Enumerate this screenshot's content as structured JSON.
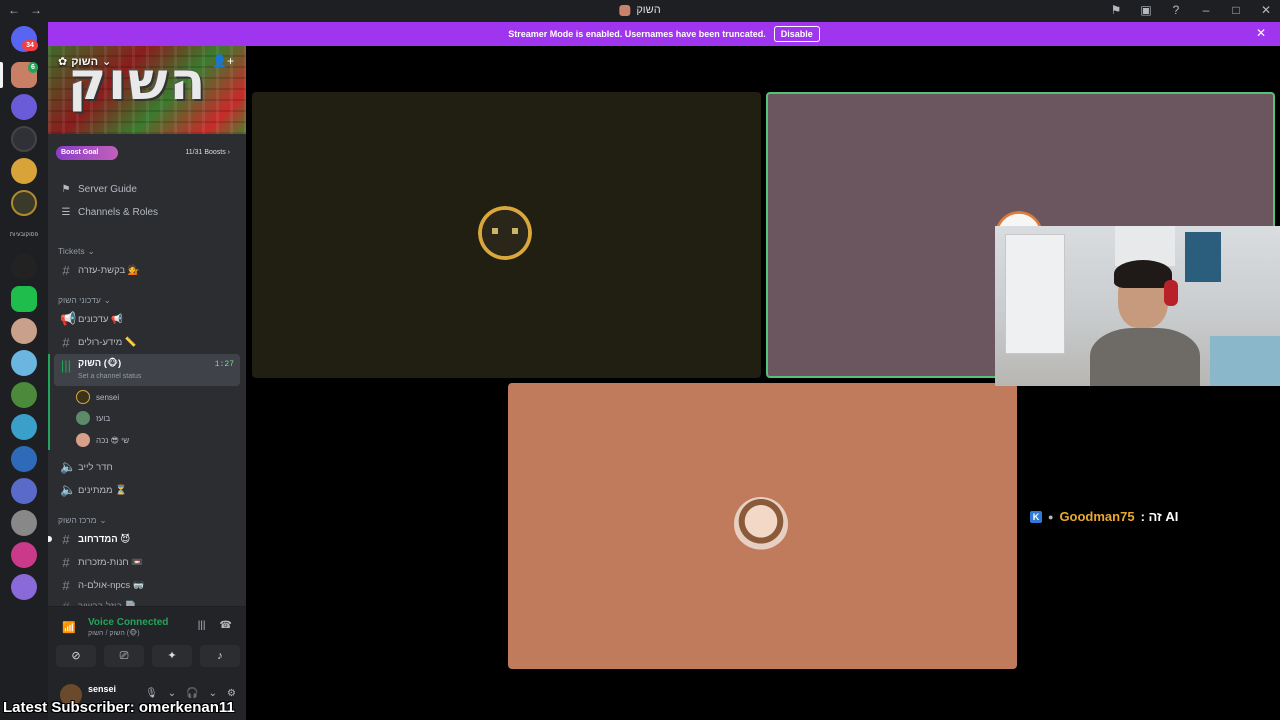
{
  "titlebar": {
    "back": "←",
    "forward": "→",
    "title": "השוק",
    "icons": [
      "flag-icon",
      "inbox-icon",
      "help-icon",
      "minimize-icon",
      "maximize-icon",
      "close-icon"
    ],
    "glyphs": [
      "⚑",
      "▣",
      "?",
      "–",
      "□",
      "✕"
    ]
  },
  "rail": {
    "dm_badge": "34",
    "server_badge": "6",
    "text_label": "פסוקובעיות"
  },
  "banner": {
    "message": "Streamer Mode is enabled. Usernames have been truncated.",
    "disable_label": "Disable",
    "color": "#a035f0"
  },
  "server": {
    "name": "השוק",
    "banner_text": "השוק"
  },
  "boost": {
    "label": "Boost Goal",
    "count": "11/31 Boosts"
  },
  "sidebar": {
    "server_guide": "Server Guide",
    "channels_roles": "Channels & Roles",
    "cat_tickets": "Tickets",
    "chan_help": "בקשת-עזרה 💁",
    "cat_updates": "עדכוני השוק",
    "chan_updates": "עדכונים 📢",
    "chan_roles": "מידע-רולים 📏",
    "voice_active": "השוק (🐵)",
    "voice_time": "1:27",
    "voice_status": "Set a channel status",
    "voice_users": [
      "sensei",
      "בועז",
      "שי 😎 נכה"
    ],
    "chan_live": "חדר לייב",
    "chan_waiting": "ממתינים ⏳",
    "cat_center": "מרכז השוק",
    "chan_guide": "המדרחוב 😈",
    "chan_store": "חנות-מזכרות 📼",
    "chan_npcs": "אולם-ה-npcs 🥽",
    "chan_cut": "ביזל ברשור 📄"
  },
  "voice_panel": {
    "title": "Voice Connected",
    "subtitle": "השוק / השוק (🐵)"
  },
  "user_panel": {
    "username": "sensei"
  },
  "overlay": {
    "chat_user": "Goodman75",
    "chat_msg": ": זה AI",
    "subscriber": "Latest Subscriber: omerkenan11"
  },
  "colors": {
    "accent": "#a035f0",
    "connected": "#23a559",
    "speaking_border": "#55c27a"
  }
}
